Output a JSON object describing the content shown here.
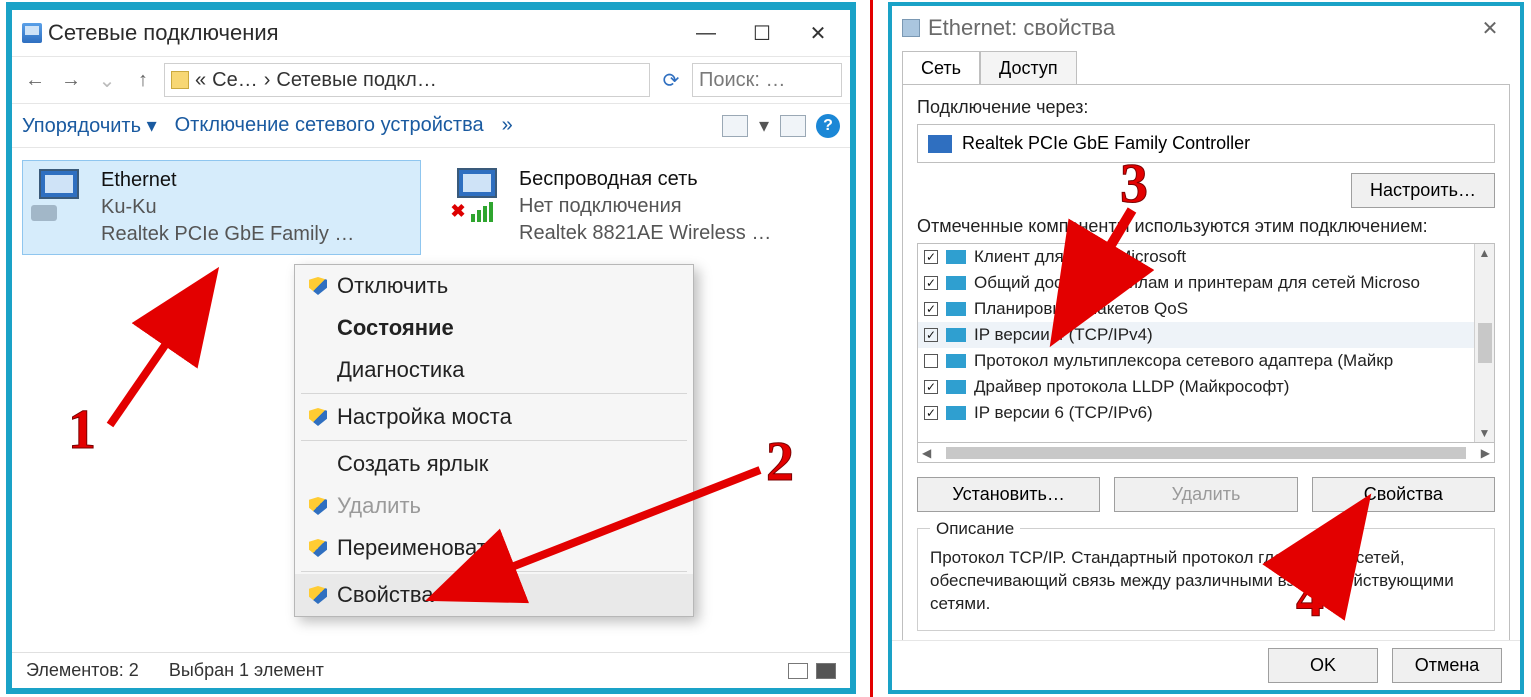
{
  "win1": {
    "title": "Сетевые подключения",
    "nav": {
      "crumb1": "Се…",
      "crumb2": "Сетевые подкл…",
      "search_placeholder": "Поиск: …"
    },
    "toolbar": {
      "sort": "Упорядочить",
      "disable": "Отключение сетевого устройства",
      "more": "»"
    },
    "connections": {
      "eth": {
        "name": "Ethernet",
        "net": "Ku-Ku",
        "dev": "Realtek PCIe GbE Family …"
      },
      "wifi": {
        "name": "Беспроводная сеть",
        "net": "Нет подключения",
        "dev": "Realtek 8821AE Wireless …"
      }
    },
    "ctx": {
      "disable": "Отключить",
      "status": "Состояние",
      "diag": "Диагностика",
      "bridge": "Настройка моста",
      "shortcut": "Создать ярлык",
      "delete": "Удалить",
      "rename": "Переименовать",
      "props": "Свойства"
    },
    "status": {
      "count": "Элементов: 2",
      "selected": "Выбран 1 элемент"
    }
  },
  "win2": {
    "title": "Ethernet: свойства",
    "tabs": {
      "net": "Сеть",
      "access": "Доступ"
    },
    "connect_via": "Подключение через:",
    "adapter": "Realtek PCIe GbE Family Controller",
    "configure": "Настроить…",
    "components_label": "Отмеченные компоненты используются этим подключением:",
    "components": [
      {
        "checked": true,
        "label": "Клиент для сетей Microsoft"
      },
      {
        "checked": true,
        "label": "Общий доступ к файлам и принтерам для сетей Microso"
      },
      {
        "checked": true,
        "label": "Планировщик пакетов QoS"
      },
      {
        "checked": true,
        "label": "IP версии 4 (TCP/IPv4)",
        "selected": true
      },
      {
        "checked": false,
        "label": "Протокол мультиплексора сетевого адаптера (Майкр"
      },
      {
        "checked": true,
        "label": "Драйвер протокола LLDP (Майкрософт)"
      },
      {
        "checked": true,
        "label": "IP версии 6 (TCP/IPv6)"
      }
    ],
    "install": "Установить…",
    "remove": "Удалить",
    "props": "Свойства",
    "desc_legend": "Описание",
    "desc": "Протокол TCP/IP. Стандартный протокол глобальных сетей, обеспечивающий связь между различными взаимодействующими сетями.",
    "ok": "OK",
    "cancel": "Отмена"
  },
  "ann": {
    "n1": "1",
    "n2": "2",
    "n3": "3",
    "n4": "4"
  }
}
